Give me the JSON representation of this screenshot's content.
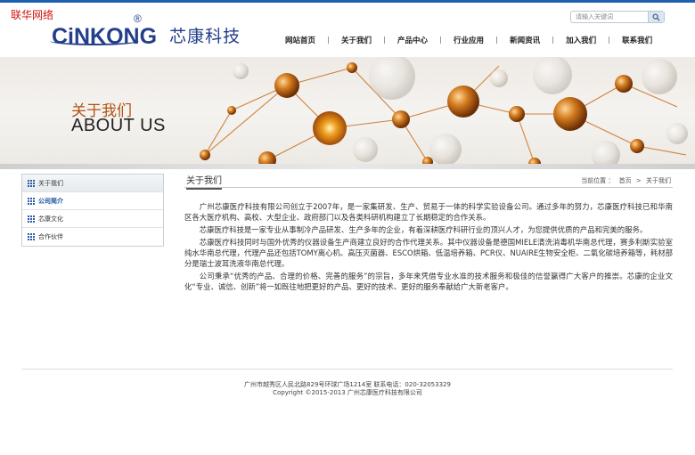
{
  "watermark": "联华网络",
  "logo": {
    "en": "CiNKONG",
    "reg": "®",
    "cn": "芯康科技"
  },
  "search": {
    "placeholder": "请输入关键词"
  },
  "nav": [
    {
      "label": "网站首页"
    },
    {
      "label": "关于我们"
    },
    {
      "label": "产品中心"
    },
    {
      "label": "行业应用"
    },
    {
      "label": "新闻资讯"
    },
    {
      "label": "加入我们"
    },
    {
      "label": "联系我们"
    }
  ],
  "banner": {
    "title_cn": "关于我们",
    "title_en": "ABOUT US"
  },
  "sidebar": {
    "items": [
      {
        "label": "关于我们"
      },
      {
        "label": "公司简介"
      },
      {
        "label": "芯康文化"
      },
      {
        "label": "合作伙伴"
      }
    ]
  },
  "content": {
    "title": "关于我们",
    "breadcrumb": {
      "prefix": "当前位置 ：",
      "home": "首页",
      "sep": ">",
      "current": "关于我们"
    },
    "paragraphs": [
      "广州芯康医疗科技有限公司创立于2007年，是一家集研发、生产、贸易于一体的科学实验设备公司。通过多年的努力，芯康医疗科技已和华南区各大医疗机构、高校、大型企业、政府部门以及各类科研机构建立了长期稳定的合作关系。",
      "芯康医疗科技是一家专业从事制冷产品研发、生产多年的企业，有着深耕医疗科研行业的顶兴人才，为您提供优质的产品和完美的服务。",
      "芯康医疗科技同时与国外优秀的仪器设备生产商建立良好的合作代理关系。其中仪器设备是德国MIELE清洗消毒机华南总代理，赛多利斯实验室纯水华南总代理，代理产品还包括TOMY离心机、高压灭菌器、ESCO烘箱、低温培养箱、PCR仪、NUAIRE生物安全柜、二氧化碳培养箱等，耗材部分是瑞士波耳洗液华南总代理。",
      "公司秉承“优秀的产品、合理的价格、完善的服务”的宗旨，多年来凭借专业水准的技术服务和极佳的信誉赢得广大客户的推崇。芯康的企业文化“专业、诚信、创新”将一如既往地把更好的产品、更好的技术、更好的服务奉献给广大新老客户。"
    ]
  },
  "footer": {
    "line1": "广州市越秀区人民北路829号环球广场1214室  联系电话：020-32053329",
    "line2": "Copyright ©2015-2013 广州芯康医疗科技有限公司"
  },
  "colors": {
    "brand": "#233e8a",
    "accent_orange": "#c8741a",
    "topline": "#1e5fae"
  }
}
